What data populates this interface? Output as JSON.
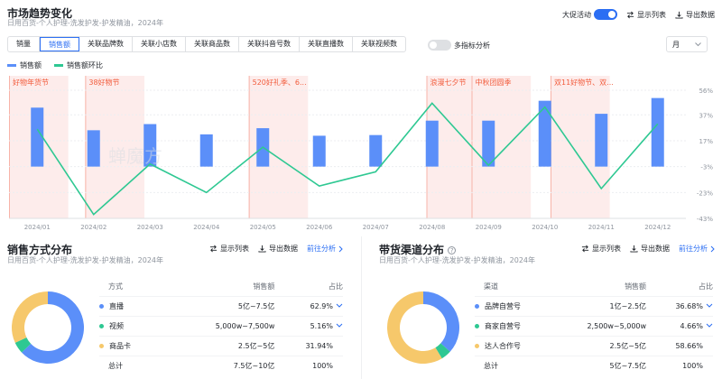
{
  "header": {
    "title": "市场趋势变化",
    "subtitle": "日用百货-个人护理-洗发护发-护发精油，2024年",
    "promo_label": "大促活动",
    "show_list": "显示列表",
    "export": "导出数据"
  },
  "metric_tabs": [
    "销量",
    "销售额",
    "关联品牌数",
    "关联小店数",
    "关联商品数",
    "关联抖音号数",
    "关联直播数",
    "关联视频数"
  ],
  "active_tab": "销售额",
  "multi_metric_label": "多指标分析",
  "period_select": "月",
  "legend": {
    "bar": "销售额",
    "line": "销售额环比"
  },
  "colors": {
    "bar": "#5b8ff9",
    "line": "#2ec892",
    "accent": "#2b6ef3",
    "promo_band": "#fdeceb",
    "promo_text": "#f25c3c"
  },
  "promos": [
    "好物年货节",
    "38好物节",
    "520好礼季、6...",
    "浪漫七夕节",
    "中秋团圆季",
    "双11好物节、双..."
  ],
  "chart_data": {
    "type": "bar",
    "categories": [
      "2024/01",
      "2024/02",
      "2024/03",
      "2024/04",
      "2024/05",
      "2024/06",
      "2024/07",
      "2024/08",
      "2024/09",
      "2024/10",
      "2024/11",
      "2024/12"
    ],
    "bar_values": [
      0.86,
      0.53,
      0.62,
      0.47,
      0.56,
      0.45,
      0.46,
      0.67,
      0.67,
      0.96,
      0.77,
      1.0
    ],
    "line_pct": [
      26,
      -40,
      -1,
      -23,
      12,
      -18,
      -7,
      46,
      -2,
      43,
      -20,
      30
    ],
    "y_right_ticks": [
      "56%",
      "37%",
      "17%",
      "-3%",
      "-23%",
      "-43%"
    ],
    "y_range_pct": [
      -43,
      56
    ]
  },
  "watermark": "蝉魔方",
  "left_panel": {
    "title": "销售方式分布",
    "subtitle": "日用百货-个人护理-洗发护发-护发精油，2024年",
    "show_list": "显示列表",
    "export": "导出数据",
    "goto": "前往分析",
    "headers": [
      "方式",
      "销售额",
      "占比"
    ],
    "rows": [
      {
        "name": "直播",
        "range": "5亿~7.5亿",
        "pct": "62.9%",
        "color": "#5b8ff9",
        "share": 62.9
      },
      {
        "name": "视频",
        "range": "5,000w~7,500w",
        "pct": "5.16%",
        "color": "#2ec892",
        "share": 5.16
      },
      {
        "name": "商品卡",
        "range": "2.5亿~5亿",
        "pct": "31.94%",
        "color": "#f6c86b",
        "share": 31.94
      }
    ],
    "total": {
      "name": "总计",
      "range": "7.5亿~10亿",
      "pct": "100%"
    }
  },
  "right_panel": {
    "title": "带货渠道分布",
    "subtitle": "日用百货-个人护理-洗发护发-护发精油，2024年",
    "show_list": "显示列表",
    "export": "导出数据",
    "goto": "前往分析",
    "headers": [
      "渠道",
      "销售额",
      "占比"
    ],
    "rows": [
      {
        "name": "品牌自营号",
        "range": "1亿~2.5亿",
        "pct": "36.68%",
        "color": "#5b8ff9",
        "share": 36.68
      },
      {
        "name": "商家自营号",
        "range": "2,500w~5,000w",
        "pct": "4.66%",
        "color": "#2ec892",
        "share": 4.66
      },
      {
        "name": "达人合作号",
        "range": "2.5亿~5亿",
        "pct": "58.66%",
        "color": "#f6c86b",
        "share": 58.66
      }
    ],
    "total": {
      "name": "总计",
      "range": "5亿~7.5亿",
      "pct": "100%"
    }
  }
}
